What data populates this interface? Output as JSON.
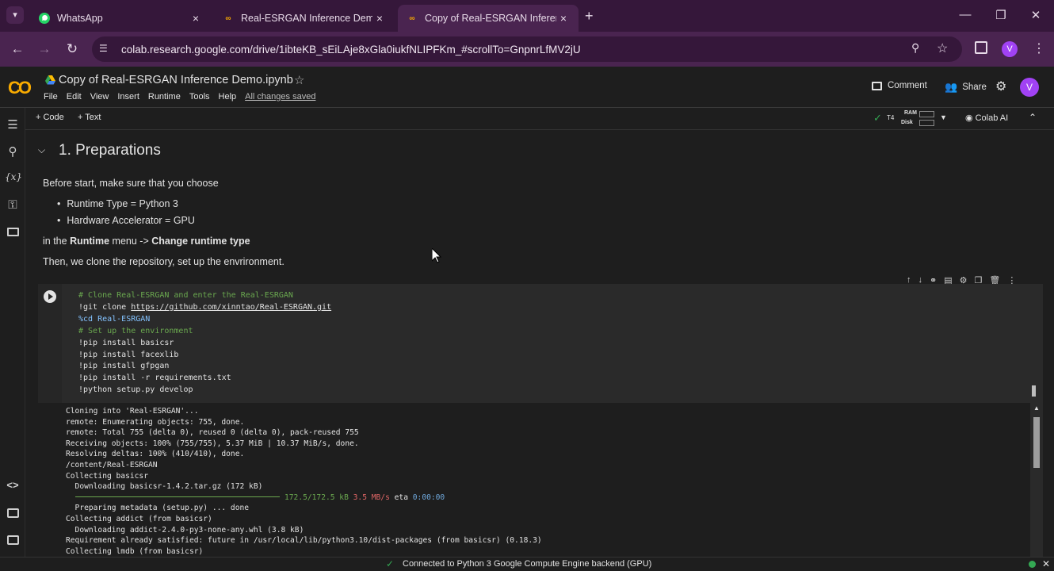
{
  "browser": {
    "tabs": [
      {
        "title": "WhatsApp",
        "close": "×"
      },
      {
        "title": "Real-ESRGAN Inference Demo.i",
        "close": "×"
      },
      {
        "title": "Copy of Real-ESRGAN Inference",
        "close": "×"
      }
    ],
    "new_tab": "+",
    "url": "colab.research.google.com/drive/1ibteKB_sEiLAje8xGla0iukfNLIPFKm_#scrollTo=GnpnrLfMV2jU",
    "profile_initial": "V"
  },
  "colab": {
    "logo": "CO",
    "notebook_title": "Copy of Real-ESRGAN Inference Demo.ipynb",
    "menus": [
      "File",
      "Edit",
      "View",
      "Insert",
      "Runtime",
      "Tools",
      "Help"
    ],
    "saved_status": "All changes saved",
    "comment_label": "Comment",
    "share_label": "Share",
    "profile_initial": "V",
    "add_code": "+ Code",
    "add_text": "+ Text",
    "runtime_type": "T4",
    "ram_label": "RAM",
    "disk_label": "Disk",
    "colab_ai": "Colab AI"
  },
  "section": {
    "title": "1. Preparations",
    "intro": "Before start, make sure that you choose",
    "bullets": [
      "Runtime Type = Python 3",
      "Hardware Accelerator = GPU"
    ],
    "runtime_pre": "in the ",
    "runtime_menu": "Runtime",
    "runtime_mid": " menu -> ",
    "runtime_change": "Change runtime type",
    "then": "Then, we clone the repository, set up the envrironment."
  },
  "code_cell": {
    "lines": [
      {
        "text": "# Clone Real-ESRGAN and enter the Real-ESRGAN",
        "kind": "comment"
      },
      {
        "text": "!git clone https://github.com/xinntao/Real-ESRGAN.git",
        "kind": "cmd"
      },
      {
        "text": "%cd Real-ESRGAN",
        "kind": "magic"
      },
      {
        "text": "# Set up the environment",
        "kind": "comment"
      },
      {
        "text": "!pip install basicsr",
        "kind": "cmd"
      },
      {
        "text": "!pip install facexlib",
        "kind": "cmd"
      },
      {
        "text": "!pip install gfpgan",
        "kind": "cmd"
      },
      {
        "text": "!pip install -r requirements.txt",
        "kind": "cmd"
      },
      {
        "text": "!python setup.py develop",
        "kind": "cmd"
      }
    ]
  },
  "output": {
    "lines": [
      "Cloning into 'Real-ESRGAN'...",
      "remote: Enumerating objects: 755, done.",
      "remote: Total 755 (delta 0), reused 0 (delta 0), pack-reused 755",
      "Receiving objects: 100% (755/755), 5.37 MiB | 10.37 MiB/s, done.",
      "Resolving deltas: 100% (410/410), done.",
      "/content/Real-ESRGAN",
      "Collecting basicsr",
      "  Downloading basicsr-1.4.2.tar.gz (172 kB)",
      "",
      "  Preparing metadata (setup.py) ... done",
      "Collecting addict (from basicsr)",
      "  Downloading addict-2.4.0-py3-none-any.whl (3.8 kB)",
      "Requirement already satisfied: future in /usr/local/lib/python3.10/dist-packages (from basicsr) (0.18.3)",
      "Collecting lmdb (from basicsr)"
    ],
    "progress_size": "172.5/172.5 kB",
    "progress_rate": "3.5 MB/s",
    "progress_eta_label": "eta",
    "progress_eta": "0:00:00"
  },
  "status": {
    "connected": "Connected to Python 3 Google Compute Engine backend (GPU)"
  },
  "colors": {
    "accent": "#f9ab00",
    "tabstrip": "#35173a",
    "profile": "#a142f4",
    "ok": "#34a853"
  }
}
